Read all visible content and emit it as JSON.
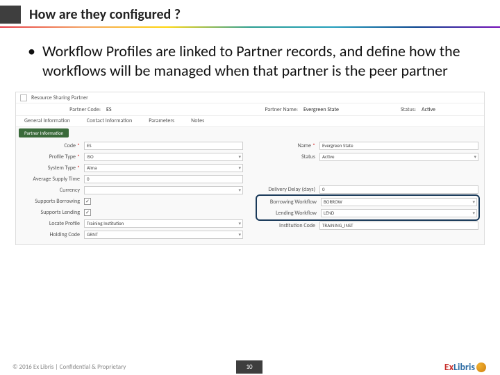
{
  "header": {
    "title": "How are they configured ?"
  },
  "bullet": {
    "text": "Workflow Profiles are linked to Partner records, and define how the workflows will be managed when that partner is the peer partner"
  },
  "top": {
    "crumb": "Resource Sharing Partner"
  },
  "partner": {
    "code_label": "Partner Code:",
    "code": "ES",
    "name_label": "Partner Name:",
    "name": "Evergreen State",
    "status_label": "Status:",
    "status": "Active"
  },
  "tabs": {
    "t1": "General Information",
    "t2": "Contact Information",
    "t3": "Parameters",
    "t4": "Notes"
  },
  "section": {
    "label": "Partner Information"
  },
  "form": {
    "left": {
      "code_l": "Code",
      "code": "ES",
      "ptype_l": "Profile Type",
      "ptype": "ISO",
      "stype_l": "System Type",
      "stype": "Alma",
      "avg_l": "Average Supply Time",
      "avg": "0",
      "cur_l": "Currency",
      "cur": "",
      "borr_l": "Supports Borrowing",
      "lend_l": "Supports Lending",
      "loc_l": "Locate Profile",
      "loc": "Training Institution",
      "hold_l": "Holding Code",
      "hold": "GRNT"
    },
    "right": {
      "name_l": "Name",
      "name": "Evergreen State",
      "status_l": "Status",
      "status": "Active",
      "delay_l": "Delivery Delay (days)",
      "delay": "0",
      "bw_l": "Borrowing Workflow",
      "bw": "BORROW",
      "lw_l": "Lending Workflow",
      "lw": "LEND",
      "inst_l": "Institution Code",
      "inst": "TRAINING_INST"
    }
  },
  "footer": {
    "copy": "© 2016 Ex Libris | Confidential & Proprietary",
    "page": "10",
    "logo_ex": "Ex",
    "logo_lib": "Libris"
  }
}
